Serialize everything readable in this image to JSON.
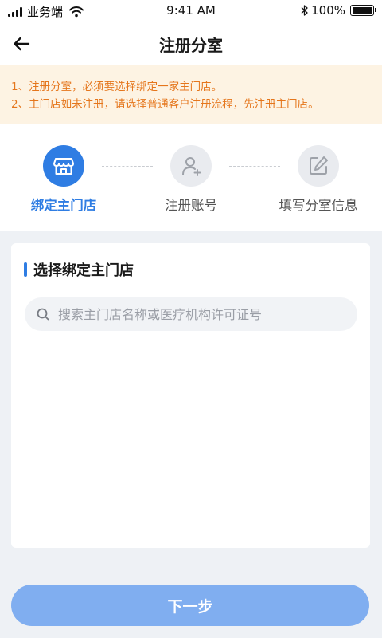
{
  "status_bar": {
    "carrier": "业务端",
    "time": "9:41 AM",
    "battery": "100%"
  },
  "nav": {
    "title": "注册分室",
    "back_icon": "arrow-left-icon"
  },
  "notice": {
    "lines": [
      "1、注册分室，必须要选择绑定一家主门店。",
      "2、主门店如未注册，请选择普通客户注册流程，先注册主门店。"
    ]
  },
  "steps": [
    {
      "label": "绑定主门店",
      "icon": "storefront-icon",
      "active": true
    },
    {
      "label": "注册账号",
      "icon": "user-add-icon",
      "active": false
    },
    {
      "label": "填写分室信息",
      "icon": "edit-icon",
      "active": false
    }
  ],
  "card": {
    "title": "选择绑定主门店",
    "search_placeholder": "搜索主门店名称或医疗机构许可证号",
    "search_value": ""
  },
  "footer": {
    "next_label": "下一步"
  },
  "colors": {
    "accent": "#2f7de3",
    "notice_bg": "#fdf3e3",
    "notice_text": "#e5761c",
    "button_disabled": "#80aef0",
    "page_bg": "#eef1f5"
  }
}
